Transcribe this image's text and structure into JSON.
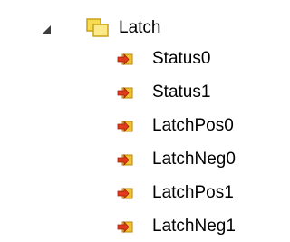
{
  "tree": {
    "root": {
      "label": "Latch",
      "expanded": true,
      "expander_icon": "expanded-triangle-icon",
      "icon": "folder-icon"
    },
    "children": [
      {
        "label": "Status0",
        "icon": "input-variable-icon"
      },
      {
        "label": "Status1",
        "icon": "input-variable-icon"
      },
      {
        "label": "LatchPos0",
        "icon": "input-variable-icon"
      },
      {
        "label": "LatchNeg0",
        "icon": "input-variable-icon"
      },
      {
        "label": "LatchPos1",
        "icon": "input-variable-icon"
      },
      {
        "label": "LatchNeg1",
        "icon": "input-variable-icon"
      }
    ]
  },
  "colors": {
    "background": "#ffffff",
    "text": "#000000",
    "expander": "#3c3c3c",
    "folder_fill": "#f6dc50",
    "folder_border": "#c9a21a",
    "var_arrow": "#e03b1c",
    "var_box": "#f2c230"
  }
}
